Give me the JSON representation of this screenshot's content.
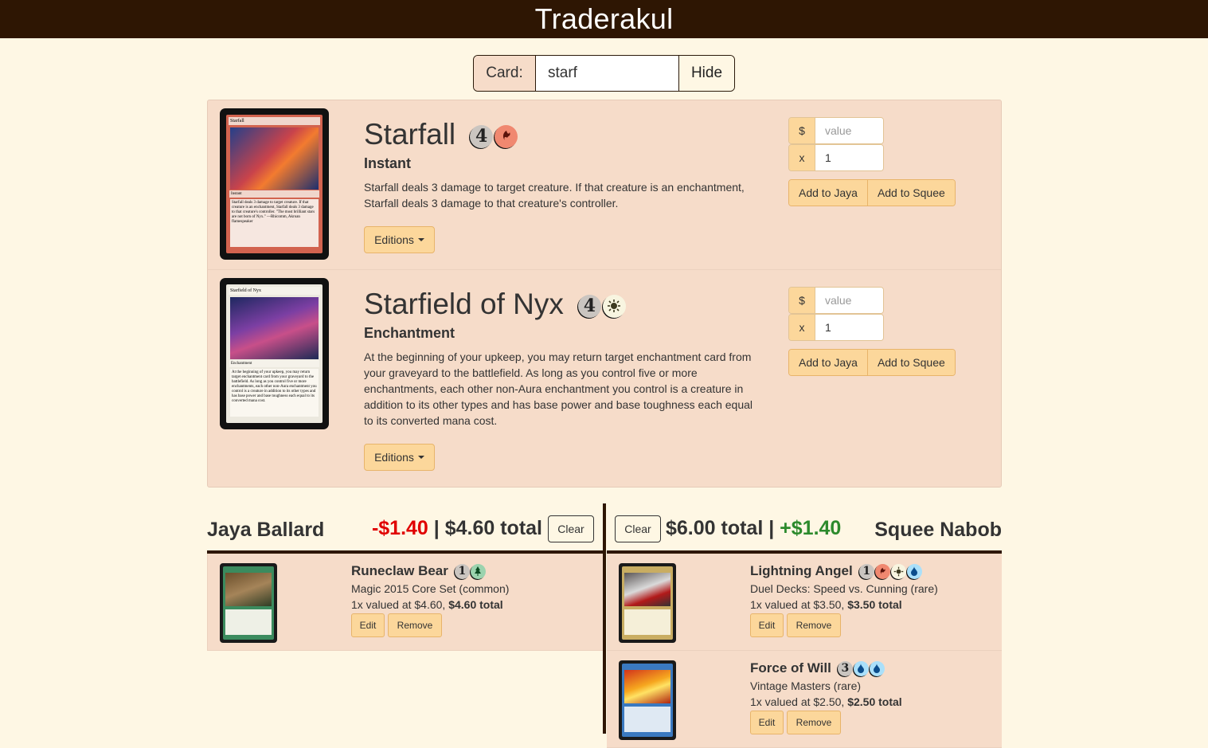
{
  "app": {
    "title": "Traderakul"
  },
  "search": {
    "label": "Card:",
    "value": "starf",
    "hide_label": "Hide"
  },
  "results": [
    {
      "name": "Starfall",
      "type": "Instant",
      "text": "Starfall deals 3 damage to target creature. If that creature is an enchantment, Starfall deals 3 damage to that creature's controller.",
      "mana": [
        "4",
        "R"
      ],
      "image": {
        "name": "Starfall",
        "type": "Instant",
        "text": "Starfall deals 3 damage to target creature. If that creature is an enchantment, Starfall deals 3 damage to that creature's controller. \"The most brilliant stars are not born of Nyx.\" —Rhicomm, Akroan flamespeaker"
      },
      "editions_label": "Editions",
      "value_prefix": "$",
      "value_placeholder": "value",
      "qty_prefix": "x",
      "qty_value": "1",
      "add_a": "Add to Jaya",
      "add_b": "Add to Squee"
    },
    {
      "name": "Starfield of Nyx",
      "type": "Enchantment",
      "text": "At the beginning of your upkeep, you may return target enchantment card from your graveyard to the battlefield. As long as you control five or more enchantments, each other non-Aura enchantment you control is a creature in addition to its other types and has base power and base toughness each equal to its converted mana cost.",
      "mana": [
        "4",
        "W"
      ],
      "image": {
        "name": "Starfield of Nyx",
        "type": "Enchantment",
        "text": "At the beginning of your upkeep, you may return target enchantment card from your graveyard to the battlefield. As long as you control five or more enchantments, each other non-Aura enchantment you control is a creature in addition to its other types and has base power and base toughness each equal to its converted mana cost."
      },
      "editions_label": "Editions",
      "value_prefix": "$",
      "value_placeholder": "value",
      "qty_prefix": "x",
      "qty_value": "1",
      "add_a": "Add to Jaya",
      "add_b": "Add to Squee"
    }
  ],
  "players": {
    "left": {
      "name": "Jaya Ballard",
      "diff": "-$1.40",
      "sep": " | ",
      "total": "$4.60 total",
      "clear_label": "Clear",
      "items": [
        {
          "name": "Runeclaw Bear",
          "mana": [
            "1",
            "G"
          ],
          "set": "Magic 2015 Core Set (common)",
          "value_text": "1x valued at $4.60, ",
          "value_total": "$4.60 total",
          "edit_label": "Edit",
          "remove_label": "Remove",
          "color": "green"
        }
      ]
    },
    "right": {
      "name": "Squee Nabob",
      "diff": "+$1.40",
      "sep": " | ",
      "total": "$6.00 total",
      "clear_label": "Clear",
      "items": [
        {
          "name": "Lightning Angel",
          "mana": [
            "1",
            "R",
            "W",
            "U"
          ],
          "set": "Duel Decks: Speed vs. Cunning (rare)",
          "value_text": "1x valued at $3.50, ",
          "value_total": "$3.50 total",
          "edit_label": "Edit",
          "remove_label": "Remove",
          "color": "gold"
        },
        {
          "name": "Force of Will",
          "mana": [
            "3",
            "U",
            "U"
          ],
          "set": "Vintage Masters (rare)",
          "value_text": "1x valued at $2.50, ",
          "value_total": "$2.50 total",
          "edit_label": "Edit",
          "remove_label": "Remove",
          "color": "blue"
        }
      ]
    }
  },
  "colors": {
    "header_bg": "#2e1603",
    "page_bg": "#fef7e4",
    "panel_bg": "#f6dcc9",
    "button_bg": "#fcd79b",
    "negative": "#e00000",
    "positive": "#2c8a2c"
  }
}
